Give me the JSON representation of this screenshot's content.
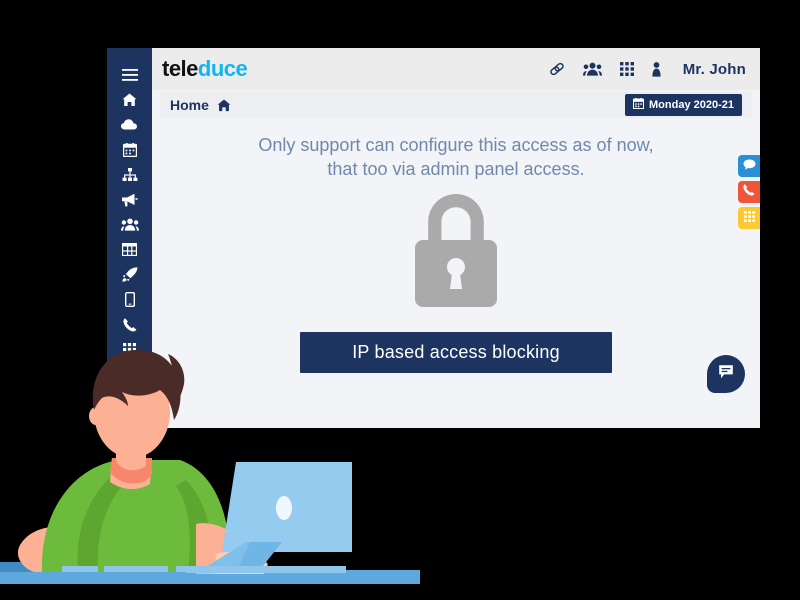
{
  "window": {
    "background_color": "#f2f4f7",
    "outer_background": "#000000"
  },
  "sidebar": {
    "background_color": "#1d3461",
    "items": [
      {
        "icon": "hamburger-menu-icon",
        "label": "Menu"
      },
      {
        "icon": "home-icon",
        "label": "Home"
      },
      {
        "icon": "cloud-icon",
        "label": "Cloud"
      },
      {
        "icon": "calendar-icon",
        "label": "Calendar"
      },
      {
        "icon": "sitemap-icon",
        "label": "Sitemap"
      },
      {
        "icon": "megaphone-icon",
        "label": "Campaigns"
      },
      {
        "icon": "people-icon",
        "label": "Contacts"
      },
      {
        "icon": "table-grid-icon",
        "label": "Reports"
      },
      {
        "icon": "rocket-icon",
        "label": "Launch"
      },
      {
        "icon": "mobile-icon",
        "label": "Mobile"
      },
      {
        "icon": "phone-icon",
        "label": "Calls"
      },
      {
        "icon": "apps-grid-icon",
        "label": "Apps"
      }
    ]
  },
  "header": {
    "background_color": "#ececec",
    "logo": {
      "part_a": "tele",
      "part_b": "duce",
      "color_a": "#111111",
      "color_b": "#12b5ef"
    },
    "icons": [
      {
        "name": "link-icon",
        "label": "Links"
      },
      {
        "name": "people-group-icon",
        "label": "Team"
      },
      {
        "name": "apps-grid-icon",
        "label": "Apps"
      },
      {
        "name": "user-icon",
        "label": "Profile"
      }
    ],
    "username": "Mr. John"
  },
  "breadcrumb": {
    "home_label": "Home",
    "home_icon": "home-icon",
    "date_badge": {
      "icon": "calendar-icon",
      "text": "Monday 2020-21",
      "background_color": "#1d3461",
      "text_color": "#ffffff"
    }
  },
  "main": {
    "notice_line_1": "Only support can configure this access as of now,",
    "notice_line_2": "that too via admin panel access.",
    "notice_color": "#7088ab",
    "lock_icon": "padlock-icon",
    "lock_color": "#aaaaaa",
    "action_button": {
      "label": "IP based access blocking",
      "background_color": "#1d3461",
      "text_color": "#ffffff"
    }
  },
  "float_tabs": [
    {
      "name": "chat-tab",
      "icon": "speech-bubble-icon",
      "color": "#2a8fd4"
    },
    {
      "name": "call-tab",
      "icon": "phone-icon",
      "color": "#ef5639"
    },
    {
      "name": "keypad-tab",
      "icon": "grid-icon",
      "color": "#fcc932"
    }
  ],
  "chat_widget": {
    "name": "chat-widget-button",
    "icon": "message-icon",
    "color": "#1d3461"
  },
  "illustration": {
    "name": "person-at-laptop-illustration",
    "colors": {
      "hair": "#4a2b28",
      "skin": "#fdb194",
      "shirt": "#6cbb3c",
      "laptop": "#95cbef",
      "desk": "#5fa8dd"
    }
  }
}
